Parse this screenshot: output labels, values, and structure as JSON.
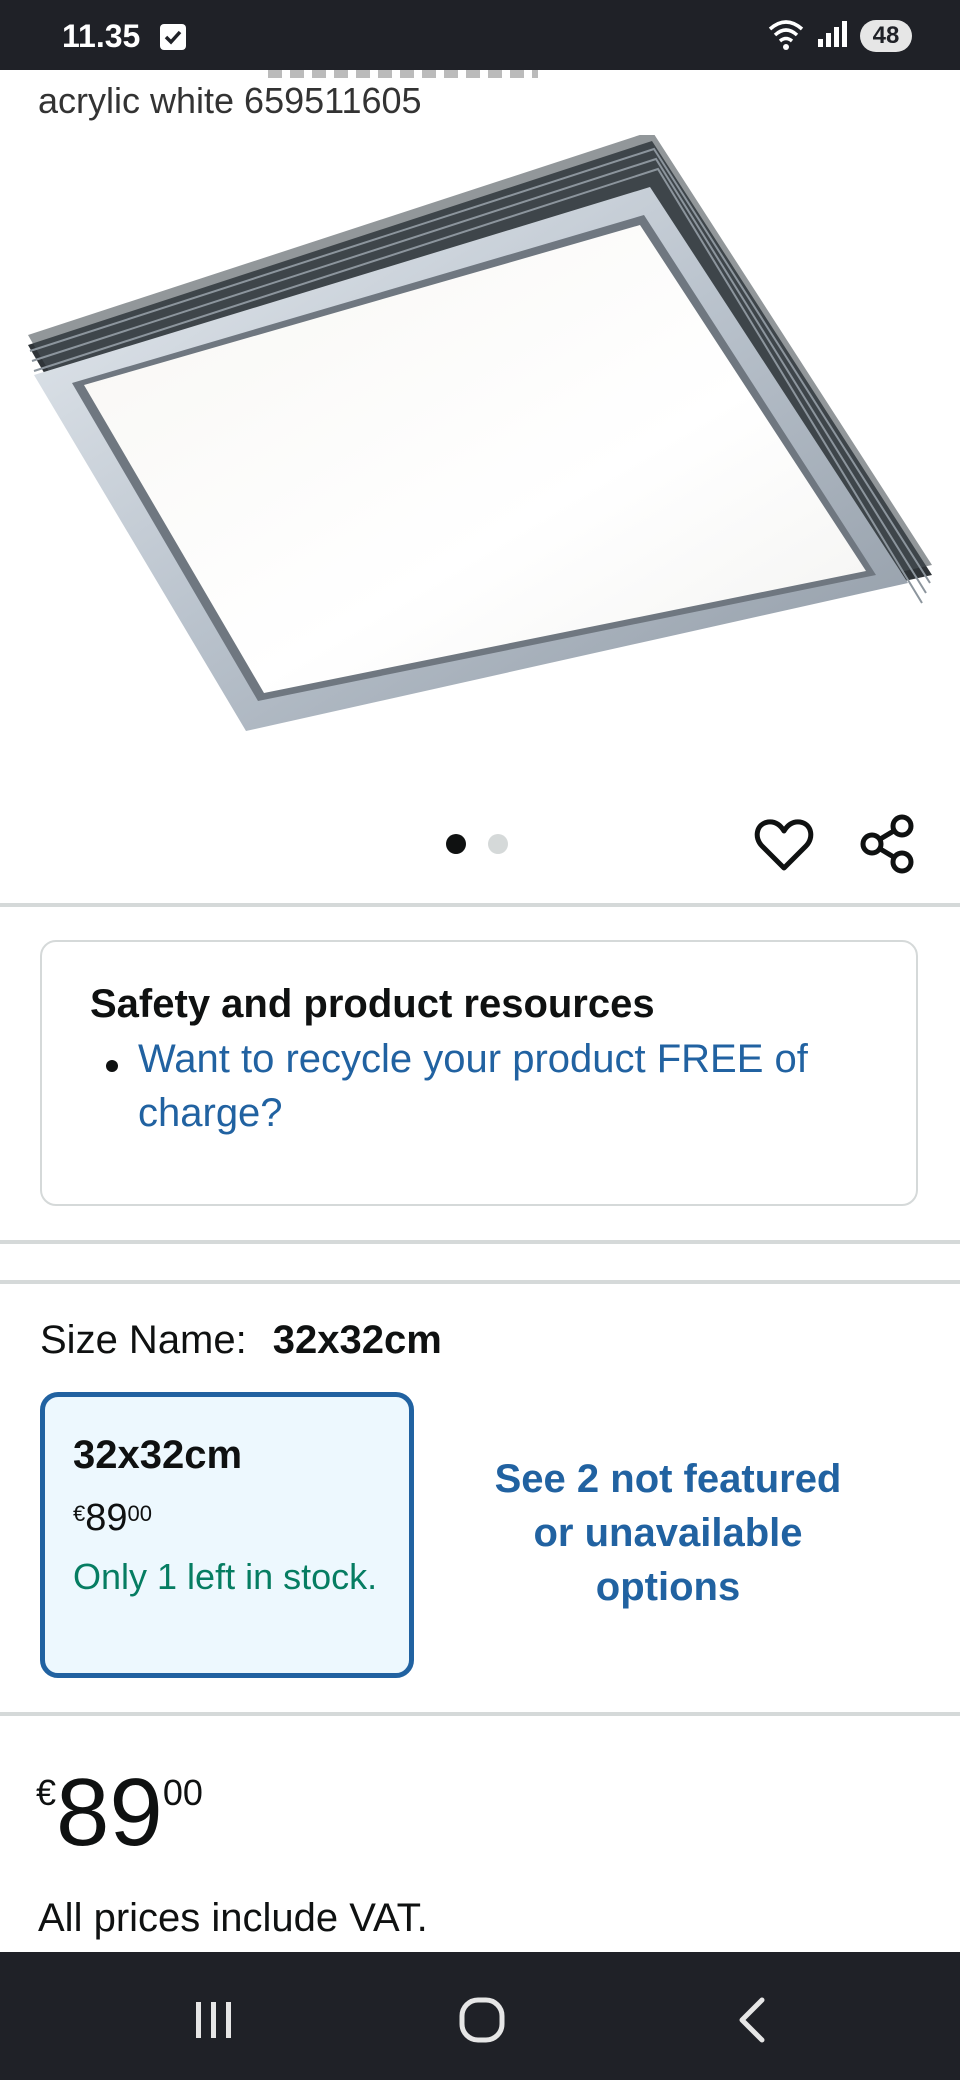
{
  "status_bar": {
    "time": "11.35",
    "battery": "48",
    "icons": [
      "checkbox-icon",
      "wifi-icon",
      "signal-icon",
      "battery-icon"
    ]
  },
  "product": {
    "title_visible": "acrylic white 659511605",
    "image_dots": {
      "count": 2,
      "active_index": 0
    }
  },
  "actions": {
    "favorite_icon": "heart-icon",
    "share_icon": "share-icon"
  },
  "safety": {
    "title": "Safety and product resources",
    "link": "Want to recycle your product FREE of charge?"
  },
  "size": {
    "label": "Size Name:",
    "selected": "32x32cm",
    "option": {
      "name": "32x32cm",
      "currency": "€",
      "whole": "89",
      "cents": "00",
      "stock": "Only 1 left in stock."
    },
    "see_more": "See 2 not featured or unavailable options"
  },
  "price": {
    "currency": "€",
    "whole": "89",
    "cents": "00",
    "vat_note": "All prices include VAT."
  },
  "colors": {
    "link": "#2162a1",
    "stock_green": "#067d62",
    "selected_bg": "#edf8fe",
    "system_bar": "#1f2127"
  }
}
